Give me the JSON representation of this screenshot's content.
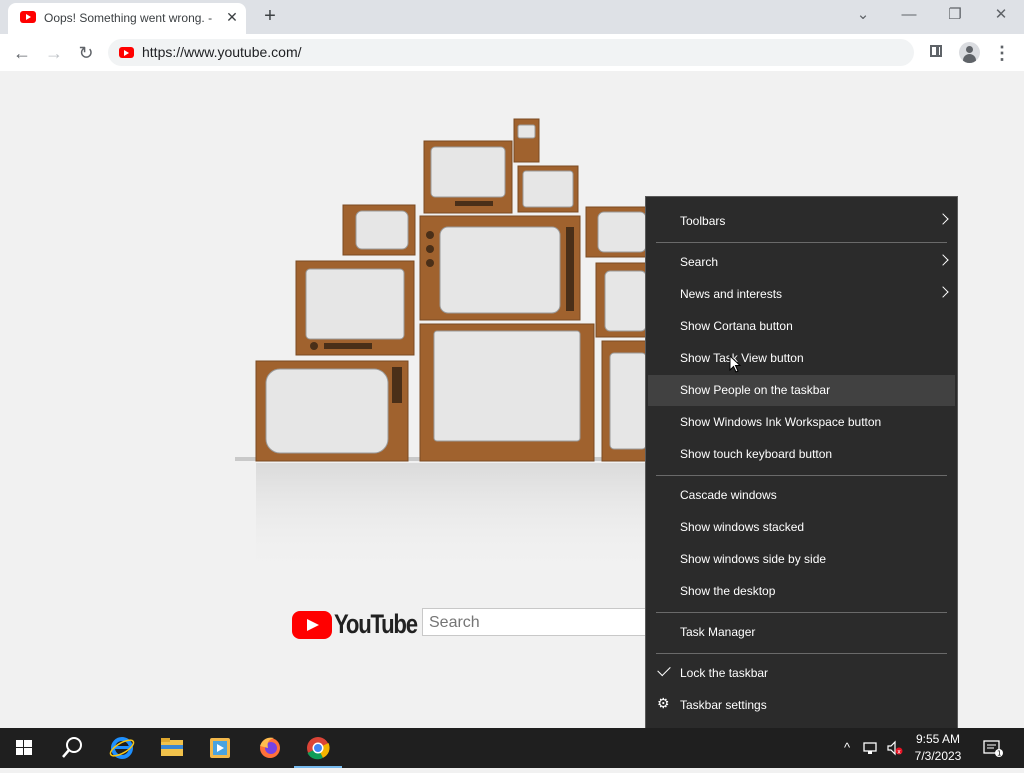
{
  "browser": {
    "tab_title": "Oops! Something went wrong. -",
    "url": "https://www.youtube.com/"
  },
  "page": {
    "logo_text": "YouTube",
    "search_placeholder": "Search"
  },
  "context_menu": {
    "items": [
      {
        "label": "Toolbars",
        "submenu": true
      },
      {
        "label": "Search",
        "submenu": true
      },
      {
        "label": "News and interests",
        "submenu": true
      },
      {
        "label": "Show Cortana button"
      },
      {
        "label": "Show Task View button"
      },
      {
        "label": "Show People on the taskbar",
        "highlighted": true
      },
      {
        "label": "Show Windows Ink Workspace button"
      },
      {
        "label": "Show touch keyboard button"
      },
      {
        "label": "Cascade windows"
      },
      {
        "label": "Show windows stacked"
      },
      {
        "label": "Show windows side by side"
      },
      {
        "label": "Show the desktop"
      },
      {
        "label": "Task Manager"
      },
      {
        "label": "Lock the taskbar",
        "checked": true
      },
      {
        "label": "Taskbar settings",
        "icon": "gear-icon"
      }
    ]
  },
  "taskbar": {
    "apps": [
      "windows-start-icon",
      "search-icon",
      "internet-explorer-icon",
      "file-explorer-icon",
      "media-player-icon",
      "firefox-icon",
      "chrome-icon"
    ],
    "time": "9:55 AM",
    "date": "7/3/2023"
  },
  "colors": {
    "youtube_red": "#ff0000",
    "menu_bg": "#2b2b2b",
    "menu_highlight": "#414141",
    "taskbar_bg": "#1f1f1f",
    "tv_wood": "#a0622e"
  }
}
